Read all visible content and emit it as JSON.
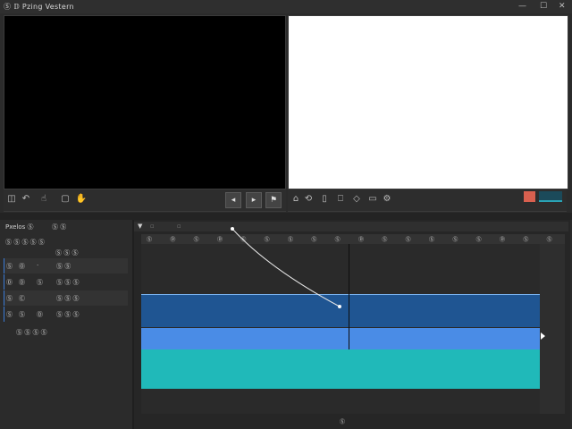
{
  "window": {
    "title": "Ⓢ 𝔻 Pzing Vestern",
    "controls": [
      "—",
      "☐",
      "✕"
    ]
  },
  "monitor_controls": {
    "source_icons": [
      "frame-icon",
      "undo-icon",
      "hand-icon",
      "crop-icon",
      "drag-icon"
    ],
    "playback_icons": [
      "step-back-icon",
      "play-icon",
      "flag-icon"
    ],
    "program_icons": [
      "tag-icon",
      "lift-icon",
      "extract-icon",
      "insert-icon",
      "overwrite-icon",
      "export-icon",
      "settings-icon"
    ],
    "swatches": [
      "#d9604f",
      "#2aa3b5"
    ]
  },
  "tracks_panel": {
    "tabs": [
      "Pxelos Ⓢ",
      "Ⓢ Ⓢ"
    ],
    "header_label": "Ⓢ Ⓢ Ⓢ Ⓢ Ⓢ",
    "rows": [
      {
        "col1": "",
        "col2": "",
        "col3": "",
        "name": "Ⓢ Ⓢ Ⓢ"
      },
      {
        "col1": "Ⓢ",
        "col2": "Ⓞ",
        "col3": "·",
        "name": "Ⓢ Ⓢ"
      },
      {
        "col1": "Ⓓ",
        "col2": "Ⓓ",
        "col3": "Ⓢ",
        "name": "Ⓢ Ⓢ Ⓢ"
      },
      {
        "col1": "Ⓢ",
        "col2": "Ⓒ",
        "col3": "",
        "name": "Ⓢ Ⓢ Ⓢ"
      },
      {
        "col1": "Ⓢ",
        "col2": "Ⓢ",
        "col3": "Ⓓ",
        "name": "Ⓢ Ⓢ Ⓢ"
      }
    ],
    "footer_label": "Ⓢ Ⓢ Ⓢ Ⓢ"
  },
  "timeline": {
    "toolbar_icons": [
      "filter-icon",
      "link-icon",
      "marker-icon"
    ],
    "ruler_ticks": [
      "Ⓢ",
      "Ⓓ",
      "Ⓢ",
      "Ⓓ",
      "Ⓢ",
      "Ⓢ",
      "Ⓢ",
      "Ⓢ",
      "Ⓢ",
      "Ⓓ",
      "Ⓢ",
      "Ⓢ",
      "Ⓢ",
      "Ⓢ",
      "Ⓢ",
      "Ⓓ",
      "Ⓢ",
      "Ⓢ"
    ],
    "timecode": "Ⓢ",
    "clip_colors": [
      "#1f5592",
      "#4a8ce6",
      "#20b9b9"
    ]
  }
}
